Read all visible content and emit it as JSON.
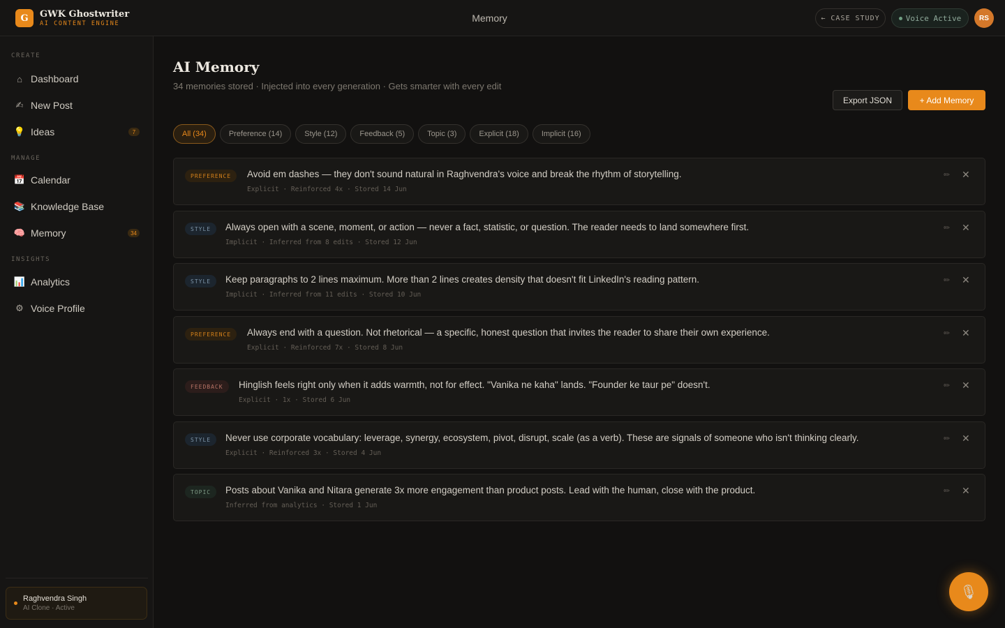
{
  "brand": {
    "logo_letter": "G",
    "name": "GWK Ghostwriter",
    "subtitle": "AI CONTENT ENGINE"
  },
  "header": {
    "title": "Memory",
    "case_study": "← CASE STUDY",
    "voice_status": "Voice Active",
    "avatar_initials": "RS"
  },
  "sidebar": {
    "sections": [
      {
        "label": "CREATE"
      },
      {
        "label": "MANAGE"
      },
      {
        "label": "INSIGHTS"
      }
    ],
    "items": [
      {
        "label": "Dashboard",
        "icon": "home-icon",
        "glyph": "⌂",
        "badge": ""
      },
      {
        "label": "New Post",
        "icon": "writing-hand-icon",
        "glyph": "✍",
        "badge": ""
      },
      {
        "label": "Ideas",
        "icon": "lightbulb-icon",
        "glyph": "💡",
        "badge": "7"
      },
      {
        "label": "Calendar",
        "icon": "calendar-icon",
        "glyph": "📅",
        "badge": ""
      },
      {
        "label": "Knowledge Base",
        "icon": "books-icon",
        "glyph": "📚",
        "badge": ""
      },
      {
        "label": "Memory",
        "icon": "brain-icon",
        "glyph": "🧠",
        "badge": "34"
      },
      {
        "label": "Analytics",
        "icon": "bar-chart-icon",
        "glyph": "📊",
        "badge": ""
      },
      {
        "label": "Voice Profile",
        "icon": "gear-icon",
        "glyph": "⚙",
        "badge": ""
      }
    ],
    "user": {
      "name": "Raghvendra Singh",
      "status": "AI Clone · Active"
    }
  },
  "main": {
    "title": "AI Memory",
    "subtitle": "34 memories stored · Injected into every generation · Gets smarter with every edit",
    "export_label": "Export JSON",
    "add_label": "+ Add Memory",
    "filters": [
      {
        "label": "All (34)",
        "active": true
      },
      {
        "label": "Preference (14)",
        "active": false
      },
      {
        "label": "Style (12)",
        "active": false
      },
      {
        "label": "Feedback (5)",
        "active": false
      },
      {
        "label": "Topic (3)",
        "active": false
      },
      {
        "label": "Explicit (18)",
        "active": false
      },
      {
        "label": "Implicit (16)",
        "active": false
      }
    ],
    "memories": [
      {
        "tag": "PREFERENCE",
        "kind": "preference",
        "text": "Avoid em dashes — they don't sound natural in Raghvendra's voice and break the rhythm of storytelling.",
        "meta": "Explicit · Reinforced 4x · Stored 14 Jun"
      },
      {
        "tag": "STYLE",
        "kind": "style",
        "text": "Always open with a scene, moment, or action — never a fact, statistic, or question. The reader needs to land somewhere first.",
        "meta": "Implicit · Inferred from 8 edits · Stored 12 Jun"
      },
      {
        "tag": "STYLE",
        "kind": "style",
        "text": "Keep paragraphs to 2 lines maximum. More than 2 lines creates density that doesn't fit LinkedIn's reading pattern.",
        "meta": "Implicit · Inferred from 11 edits · Stored 10 Jun"
      },
      {
        "tag": "PREFERENCE",
        "kind": "preference",
        "text": "Always end with a question. Not rhetorical — a specific, honest question that invites the reader to share their own experience.",
        "meta": "Explicit · Reinforced 7x · Stored 8 Jun"
      },
      {
        "tag": "FEEDBACK",
        "kind": "feedback",
        "text": "Hinglish feels right only when it adds warmth, not for effect. \"Vanika ne kaha\" lands. \"Founder ke taur pe\" doesn't.",
        "meta": "Explicit · 1x · Stored 6 Jun"
      },
      {
        "tag": "STYLE",
        "kind": "style",
        "text": "Never use corporate vocabulary: leverage, synergy, ecosystem, pivot, disrupt, scale (as a verb). These are signals of someone who isn't thinking clearly.",
        "meta": "Explicit · Reinforced 3x · Stored 4 Jun"
      },
      {
        "tag": "TOPIC",
        "kind": "topic",
        "text": "Posts about Vanika and Nitara generate 3x more engagement than product posts. Lead with the human, close with the product.",
        "meta": "Inferred from analytics · Stored 1 Jun"
      }
    ],
    "edit_glyph": "✏",
    "close_glyph": "✕"
  },
  "fab": {
    "icon": "microphone-icon",
    "glyph": "🎙"
  },
  "colors": {
    "accent": "#e8891b",
    "background": "#121110",
    "sidebar": "#161514"
  }
}
